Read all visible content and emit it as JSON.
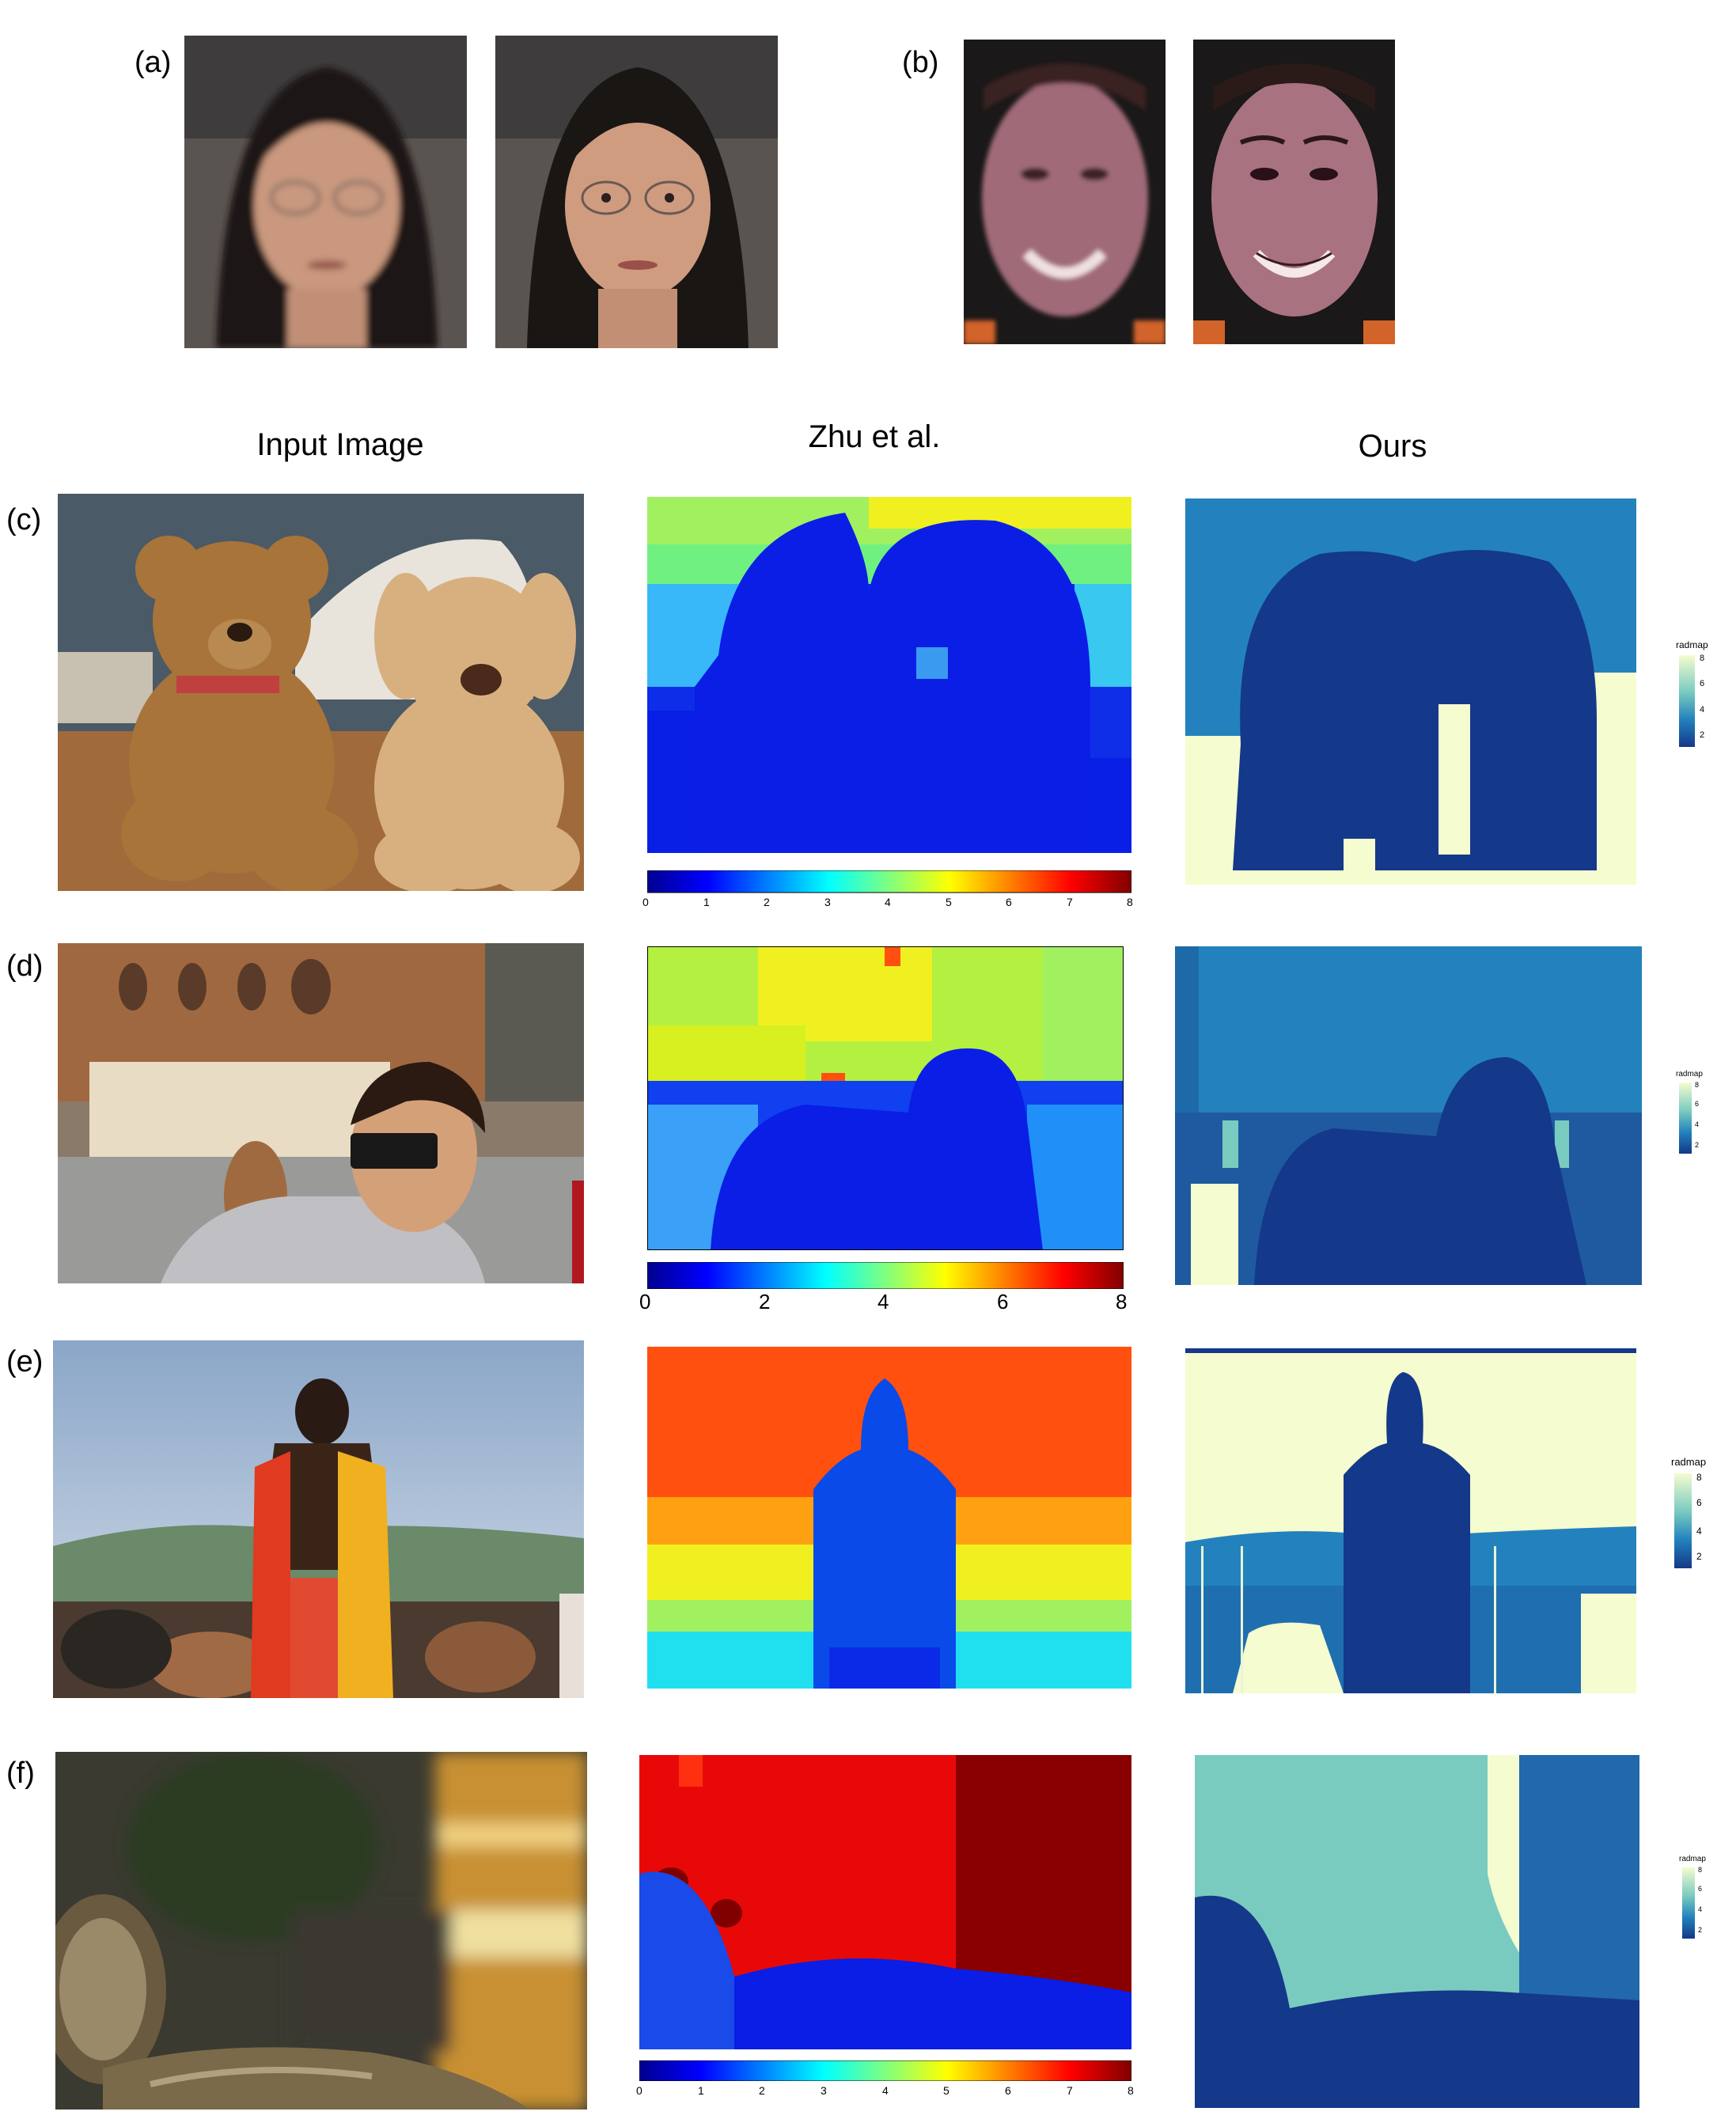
{
  "figure": {
    "row_labels": {
      "a": "(a)",
      "b": "(b)",
      "c": "(c)",
      "d": "(d)",
      "e": "(e)",
      "f": "(f)"
    },
    "column_headers": {
      "input": "Input Image",
      "zhu": "Zhu et al.",
      "ours": "Ours"
    },
    "colorbar_ticks_fine": [
      "0",
      "1",
      "2",
      "3",
      "4",
      "5",
      "6",
      "7",
      "8"
    ],
    "colorbar_ticks_coarse": [
      "0",
      "2",
      "4",
      "6",
      "8"
    ],
    "legend": {
      "title": "radmap",
      "ticks": [
        "8",
        "6",
        "4",
        "2"
      ]
    }
  },
  "colors": {
    "jet_blue": "#0a1ee6",
    "jet_cyan": "#20e0f0",
    "jet_yellow": "#f0f020",
    "jet_orange": "#ff5010",
    "jet_red": "#e00808",
    "jet_darkred": "#800000",
    "ours_dark": "#14388a",
    "ours_mid": "#2382bd",
    "ours_teal": "#7acbbf",
    "ours_pale": "#f5fccf"
  }
}
